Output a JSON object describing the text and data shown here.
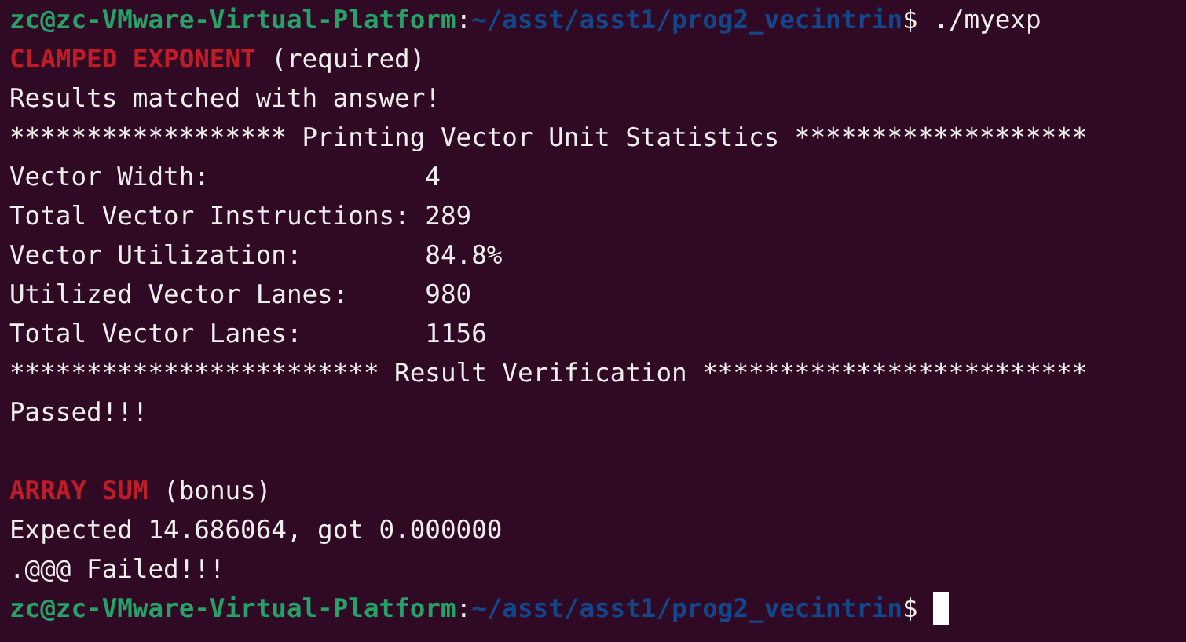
{
  "terminal": {
    "lines": [
      {
        "kind": "prompt",
        "user": "zc@zc-VMware-Virtual-Platform",
        "colon": ":",
        "path": "~/asst/asst1/prog2_vecintrin",
        "dollar": "$",
        "command": "./myexp"
      },
      {
        "kind": "section",
        "title": "CLAMPED EXPONENT",
        "note": "(required)"
      },
      {
        "kind": "text",
        "text": "Results matched with answer!"
      },
      {
        "kind": "text",
        "text": "****************** Printing Vector Unit Statistics *******************"
      },
      {
        "kind": "stat",
        "label": "Vector Width:",
        "value": "4"
      },
      {
        "kind": "stat",
        "label": "Total Vector Instructions:",
        "value": "289"
      },
      {
        "kind": "stat",
        "label": "Vector Utilization:",
        "value": "84.8%"
      },
      {
        "kind": "stat",
        "label": "Utilized Vector Lanes:",
        "value": "980"
      },
      {
        "kind": "stat",
        "label": "Total Vector Lanes:",
        "value": "1156"
      },
      {
        "kind": "text",
        "text": "************************ Result Verification *************************"
      },
      {
        "kind": "text",
        "text": "Passed!!!"
      },
      {
        "kind": "blank"
      },
      {
        "kind": "section",
        "title": "ARRAY SUM",
        "note": "(bonus)"
      },
      {
        "kind": "text",
        "text": "Expected 14.686064, got 0.000000"
      },
      {
        "kind": "text",
        "text": ".@@@ Failed!!!"
      },
      {
        "kind": "prompt",
        "user": "zc@zc-VMware-Virtual-Platform",
        "colon": ":",
        "path": "~/asst/asst1/prog2_vecintrin",
        "dollar": "$",
        "cursor": true
      }
    ]
  }
}
